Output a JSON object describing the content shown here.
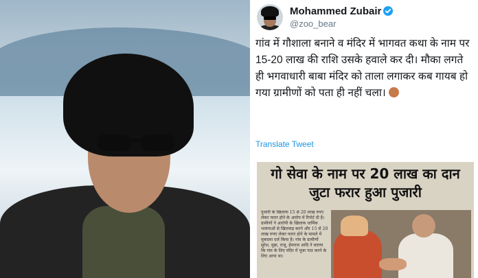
{
  "tweet": {
    "author_name": "Mohammed Zubair",
    "handle": "@zoo_bear",
    "text": "गांव में गौशाला बनाने व मंदिर में भागवत कथा के नाम पर 15-20 लाख की राशि उसके हवाले कर दी। मौका लगते ही भगवाधारी बाबा मंदिर को ताला लगाकर कब गायब हो गया ग्रामीणों को पता ही नहीं चला।",
    "translate_label": "Translate Tweet",
    "verified_color": "#1da1f2",
    "link_color": "#1b95e0"
  },
  "newspaper": {
    "headline": "गो सेवा के नाम पर 20 लाख का दान जुटा फरार हुआ पुजारी",
    "column_text": "पुजारी के खिलाफ 15 से 20 लाख रुपए लेकर फरार होने के आरोप में रिपोर्ट दी है। ग्रामीणों ने आरोपी के खिलाफ धार्मिक भावनाओं से खिलवाड़ करने और 15 से 20 लाख रुपए लेकर फरार होने के मामले में मुकदमा दर्ज किया है। गांव के ग्रामीणों सुरेश, मुन्ना, राजू, हेमराज आदि ने बताया कि गांव के लिए मंदिर में पूजा पाठ करने के लिए आया था।"
  },
  "icons": {
    "verified": "verified-badge-icon",
    "emoji": "person-bowing-emoji-icon"
  }
}
